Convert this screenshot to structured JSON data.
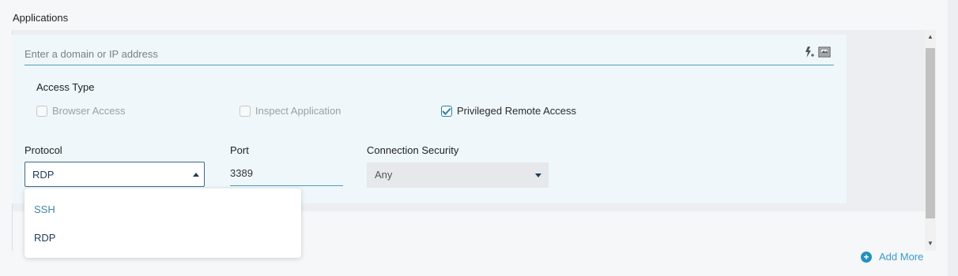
{
  "section_title": "Applications",
  "domain_input": {
    "placeholder": "Enter a domain or IP address",
    "value": ""
  },
  "field_icons": [
    "lightning-plus-icon",
    "image-icon"
  ],
  "access_type": {
    "title": "Access Type",
    "options": [
      {
        "label": "Browser Access",
        "checked": false,
        "disabled": true
      },
      {
        "label": "Inspect Application",
        "checked": false,
        "disabled": true
      },
      {
        "label": "Privileged Remote Access",
        "checked": true,
        "disabled": false
      }
    ]
  },
  "protocol": {
    "label": "Protocol",
    "value": "RDP",
    "options": [
      "SSH",
      "RDP"
    ]
  },
  "port": {
    "label": "Port",
    "value": "3389"
  },
  "connection_security": {
    "label": "Connection Security",
    "value": "Any"
  },
  "add_more": {
    "label": "Add More"
  },
  "colors": {
    "accent": "#2490c0",
    "card_bg": "#eff7fb",
    "underline": "#4c9fb3"
  }
}
